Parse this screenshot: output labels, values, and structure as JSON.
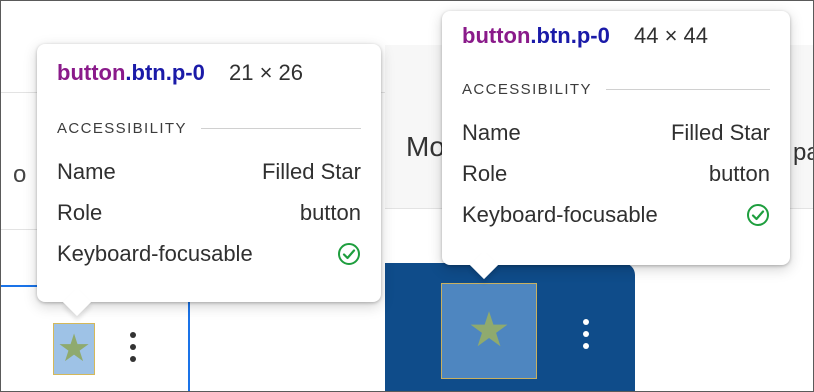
{
  "left_tooltip": {
    "selector_tag": "button",
    "selector_cls": "btn.p-0",
    "dims": "21 × 26",
    "section": "ACCESSIBILITY",
    "name_label": "Name",
    "name_value": "Filled Star",
    "role_label": "Role",
    "role_value": "button",
    "focus_label": "Keyboard-focusable",
    "focus_icon": "check-circle-icon"
  },
  "right_tooltip": {
    "selector_tag": "button",
    "selector_cls": "btn.p-0",
    "dims": "44 × 44",
    "section": "ACCESSIBILITY",
    "name_label": "Name",
    "name_value": "Filled Star",
    "role_label": "Role",
    "role_value": "button",
    "focus_label": "Keyboard-focusable",
    "focus_icon": "check-circle-icon"
  },
  "background": {
    "left_ghost": "o",
    "right_ghost_left": "Mo",
    "right_ghost_right": "pa"
  },
  "colors": {
    "selector_tag": "#8a1a8a",
    "selector_class": "#1a1aa8",
    "check_green": "#1e9e3e",
    "dark_card": "#0f4c8a",
    "focus_accent": "#1a73e8"
  }
}
